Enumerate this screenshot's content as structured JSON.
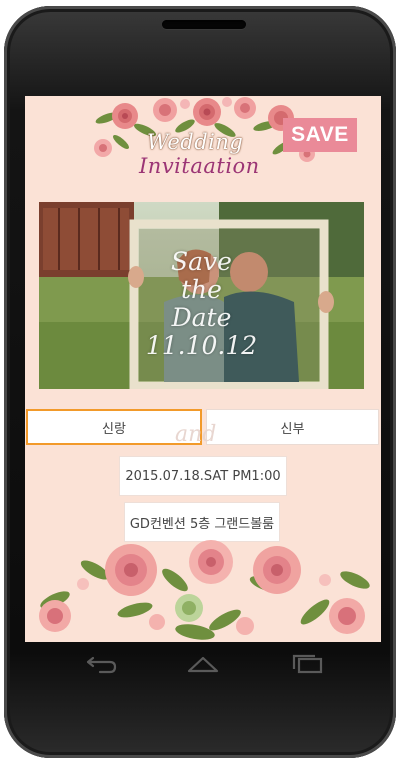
{
  "header": {
    "title_line1": "Wedding",
    "title_line2": "Invitaation",
    "save_label": "SAVE"
  },
  "photo": {
    "overlay_lines": [
      "Save",
      "the",
      "Date",
      "11.10.12"
    ]
  },
  "tabs": [
    {
      "label": "신랑",
      "selected": true
    },
    {
      "label": "신부",
      "selected": false
    }
  ],
  "and_script": "and",
  "details": {
    "datetime": "2015.07.18.SAT PM1:00",
    "venue": "GD컨벤션 5층 그랜드볼룸"
  },
  "nav": {
    "back_icon": "back-arrow-icon",
    "home_icon": "home-icon",
    "recent_icon": "recent-apps-icon"
  },
  "colors": {
    "screen_bg": "#fbe2d6",
    "save_button": "#ea8a98",
    "title_purple": "#9b3575",
    "tab_selected_border": "#f29a2a"
  }
}
